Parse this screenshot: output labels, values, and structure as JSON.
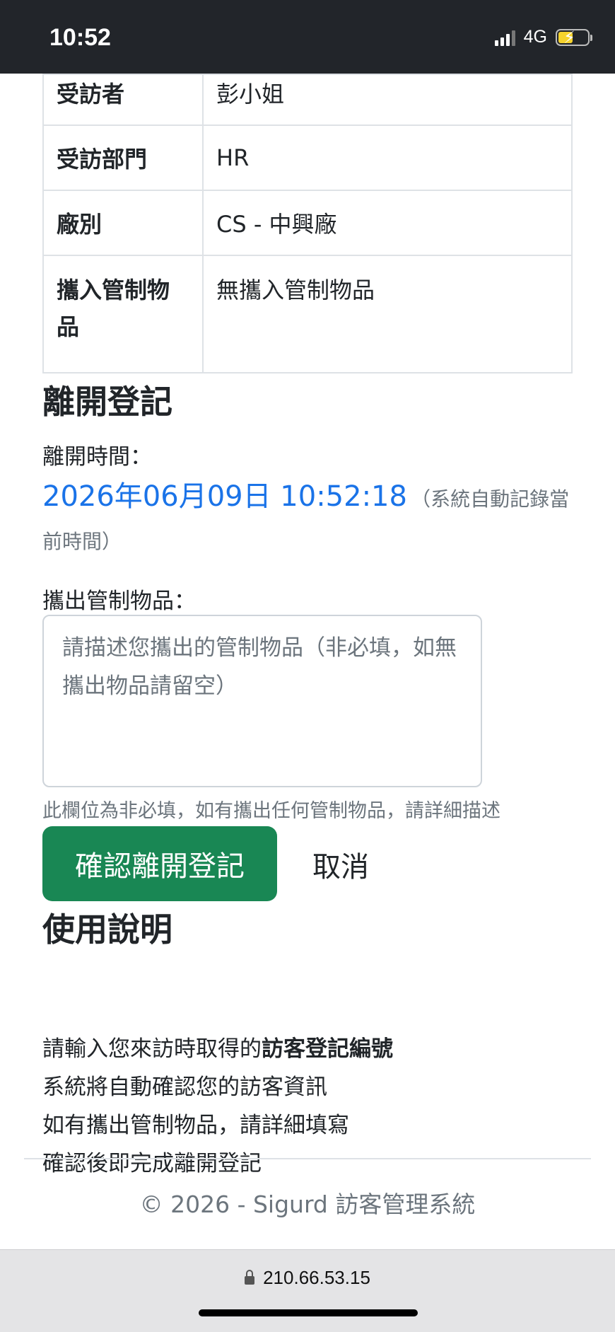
{
  "status_bar": {
    "time": "10:52",
    "network": "4G"
  },
  "visit_info": {
    "rows": [
      {
        "key": "受訪者",
        "value": "彭小姐"
      },
      {
        "key": "受訪部門",
        "value": "HR"
      },
      {
        "key": "廠別",
        "value": "CS - 中興廠"
      },
      {
        "key": "攜入管制物品",
        "value": "無攜入管制物品"
      }
    ]
  },
  "checkout": {
    "title": "離開登記",
    "time_label": "離開時間：",
    "time_value": "2026年06月09日 10:52:18",
    "time_note": "（系統自動記錄當前時間）",
    "items_label": "攜出管制物品：",
    "items_placeholder": "請描述您攜出的管制物品（非必填，如無攜出物品請留空）",
    "items_help": "此欄位為非必填，如有攜出任何管制物品，請詳細描述",
    "confirm_label": "確認離開登記",
    "cancel_label": "取消"
  },
  "instructions": {
    "title": "使用說明",
    "line1_prefix": "請輸入您來訪時取得的",
    "line1_bold": "訪客登記編號",
    "line2": "系統將自動確認您的訪客資訊",
    "line3": "如有攜出管制物品，請詳細填寫",
    "line4": "確認後即完成離開登記"
  },
  "footer": {
    "text": "© 2026 - Sigurd 訪客管理系統"
  },
  "browser": {
    "url": "210.66.53.15"
  },
  "colors": {
    "primary_time": "#1a73e8",
    "confirm_button": "#198754",
    "muted": "#6c757d"
  }
}
